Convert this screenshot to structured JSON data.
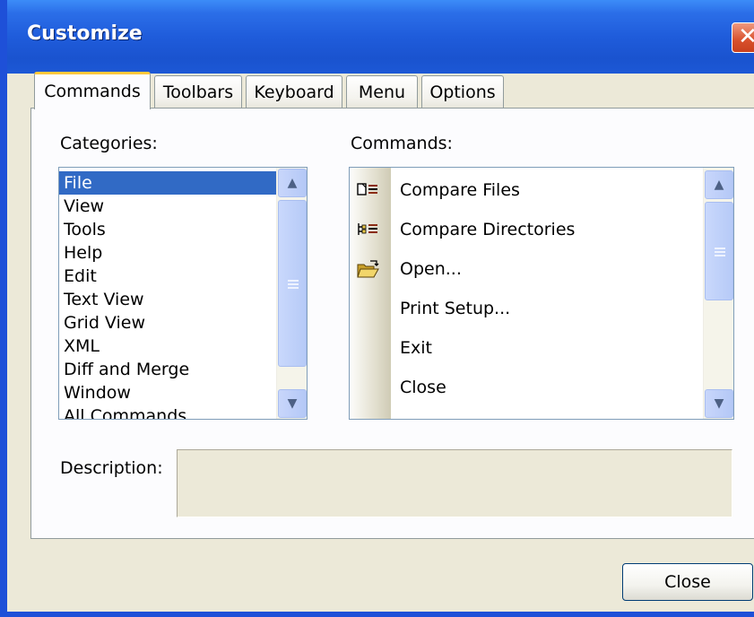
{
  "window": {
    "title": "Customize"
  },
  "tabs": [
    {
      "label": "Commands",
      "active": true
    },
    {
      "label": "Toolbars",
      "active": false
    },
    {
      "label": "Keyboard",
      "active": false
    },
    {
      "label": "Menu",
      "active": false
    },
    {
      "label": "Options",
      "active": false
    }
  ],
  "categories": {
    "label": "Categories:",
    "items": [
      "File",
      "View",
      "Tools",
      "Help",
      "Edit",
      "Text View",
      "Grid View",
      "XML",
      "Diff and Merge",
      "Window",
      "All Commands"
    ],
    "selected": "File"
  },
  "commands": {
    "label": "Commands:",
    "items": [
      {
        "label": "Compare Files",
        "icon": "compare-files-icon"
      },
      {
        "label": "Compare Directories",
        "icon": "compare-directories-icon"
      },
      {
        "label": "Open...",
        "icon": "open-folder-icon"
      },
      {
        "label": "Print Setup...",
        "icon": ""
      },
      {
        "label": "Exit",
        "icon": ""
      },
      {
        "label": "Close",
        "icon": ""
      }
    ]
  },
  "description": {
    "label": "Description:",
    "value": ""
  },
  "footer": {
    "close_label": "Close"
  },
  "colors": {
    "titlebar": "#1F5CDB",
    "selection": "#316AC5",
    "dialog_bg": "#ECE9D8",
    "active_tab_accent": "#FFC83C"
  }
}
